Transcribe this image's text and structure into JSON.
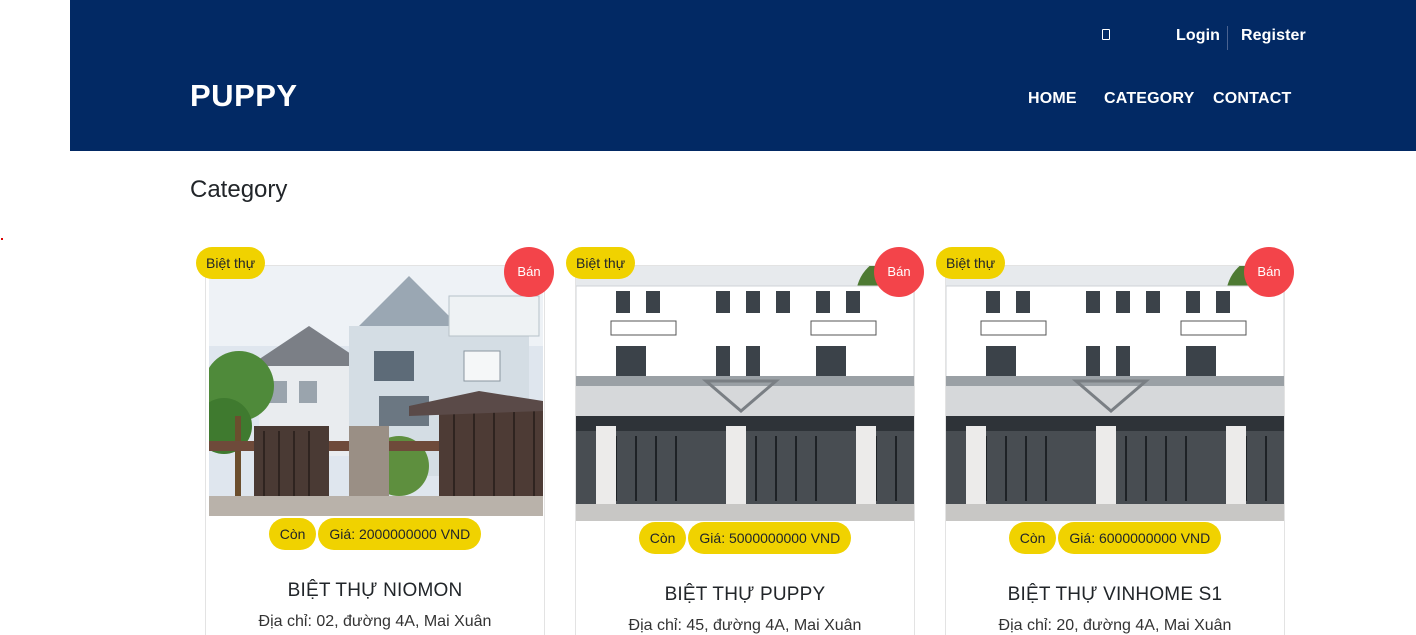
{
  "header": {
    "brand": "PUPPY",
    "auth": {
      "login": "Login",
      "register": "Register",
      "icon": "user-icon"
    },
    "nav": [
      {
        "label": "HOME"
      },
      {
        "label": "CATEGORY"
      },
      {
        "label": "CONTACT"
      }
    ]
  },
  "main": {
    "title": "Category",
    "cards": [
      {
        "type": "Biệt thự",
        "status_badge": "Bán",
        "availability": "Còn",
        "price": "Giá: 2000000000 VND",
        "name": "BIỆT THỰ NIOMON",
        "address": "Địa chỉ: 02, đường 4A, Mai Xuân",
        "image": "villa-photo-green-garden"
      },
      {
        "type": "Biệt thự",
        "status_badge": "Bán",
        "availability": "Còn",
        "price": "Giá: 5000000000 VND",
        "name": "BIỆT THỰ PUPPY",
        "address": "Địa chỉ: 45, đường 4A, Mai Xuân",
        "image": "townhouse-photo-white"
      },
      {
        "type": "Biệt thự",
        "status_badge": "Bán",
        "availability": "Còn",
        "price": "Giá: 6000000000 VND",
        "name": "BIỆT THỰ VINHOME S1",
        "address": "Địa chỉ: 20, đường 4A, Mai Xuân",
        "image": "townhouse-photo-white"
      }
    ]
  },
  "colors": {
    "header_bg": "#022964",
    "badge_yellow": "#f0d200",
    "badge_red": "#f3444a"
  }
}
